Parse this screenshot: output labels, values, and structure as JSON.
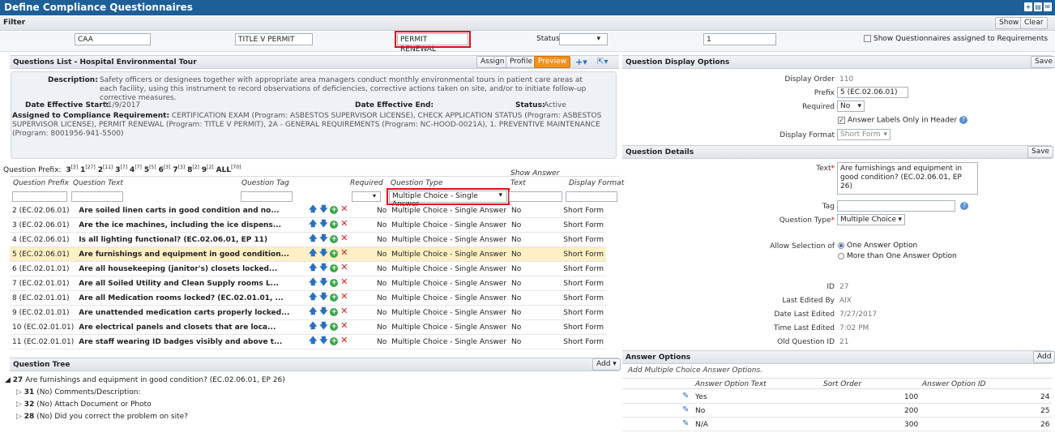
{
  "title": "Define Compliance Questionnaires",
  "filter": {
    "label": "Filter",
    "show": "Show",
    "clear": "Clear",
    "f1": "CAA",
    "f2": "TITLE V PERMIT",
    "f3": "PERMIT RENEWAL",
    "status_label": "Status",
    "status_value": "",
    "f5": "1",
    "show_assigned": "Show Questionnaires assigned to Requirements"
  },
  "qlist": {
    "title": "Questions List - Hospital Environmental Tour",
    "assign": "Assign",
    "profile": "Profile",
    "preview": "Preview",
    "description_label": "Description:",
    "description": "Safety officers or designees together with appropriate area managers conduct monthly environmental tours in patient care areas at each facility, using this instrument to record observations of deficiencies, corrective actions taken on site, and/or to initiate follow-up corrective measures.",
    "des_start_label": "Date Effective Start:",
    "des_start": "01/9/2017",
    "des_end_label": "Date Effective End:",
    "status_label": "Status:",
    "status": "Active",
    "assigned_label": "Assigned to Compliance Requirement:",
    "assigned": "CERTIFICATION EXAM (Program: ASBESTOS SUPERVISOR LICENSE), CHECK APPLICATION STATUS (Program: ASBESTOS SUPERVISOR LICENSE), PERMIT RENEWAL (Program: TITLE V PERMIT), 2A - GENERAL REQUIREMENTS (Program: NC-HOOD-0021A), 1. PREVENTIVE MAINTENANCE (Program: 8001956-941-5500)",
    "prefix_label": "Question Prefix:",
    "prefixes": [
      {
        "p": "3",
        "c": "[3]"
      },
      {
        "p": "1",
        "c": "[27]"
      },
      {
        "p": "2",
        "c": "[11]"
      },
      {
        "p": "3",
        "c": "[7]"
      },
      {
        "p": "4",
        "c": "[7]"
      },
      {
        "p": "5",
        "c": "[5]"
      },
      {
        "p": "6",
        "c": "[3]"
      },
      {
        "p": "7",
        "c": "[3]"
      },
      {
        "p": "8",
        "c": "[2]"
      },
      {
        "p": "9",
        "c": "[2]"
      },
      {
        "p": "ALL",
        "c": "[70]"
      }
    ],
    "col_prefix": "Question Prefix",
    "col_text": "Question Text",
    "col_tag": "Question Tag",
    "col_required": "Required",
    "col_type": "Question Type",
    "col_show_answer_1": "Show Answer",
    "col_show_answer_2": "Text",
    "col_display": "Display Format",
    "type_filter": "Multiple Choice - Single Answer",
    "rows": [
      {
        "prefix": "2 (EC.02.06.01)",
        "text": "Are soiled linen carts in good condition and no...",
        "req": "No",
        "type": "Multiple Choice - Single Answer",
        "show": "No",
        "fmt": "Short Form"
      },
      {
        "prefix": "3 (EC.02.06.01)",
        "text": "Are the ice machines, including the ice dispens...",
        "req": "No",
        "type": "Multiple Choice - Single Answer",
        "show": "No",
        "fmt": "Short Form"
      },
      {
        "prefix": "4 (EC.02.06.01)",
        "text": "Is all lighting functional? (EC.02.06.01, EP 11)",
        "req": "No",
        "type": "Multiple Choice - Single Answer",
        "show": "No",
        "fmt": "Short Form"
      },
      {
        "prefix": "5 (EC.02.06.01)",
        "text": "Are furnishings and equipment in good condition...",
        "req": "No",
        "type": "Multiple Choice - Single Answer",
        "show": "No",
        "fmt": "Short Form"
      },
      {
        "prefix": "6 (EC.02.01.01)",
        "text": "Are all housekeeping (janitor's) closets locked...",
        "req": "No",
        "type": "Multiple Choice - Single Answer",
        "show": "No",
        "fmt": "Short Form"
      },
      {
        "prefix": "7 (EC.02.01.01)",
        "text": "Are all Soiled Utility and Clean Supply rooms L...",
        "req": "No",
        "type": "Multiple Choice - Single Answer",
        "show": "No",
        "fmt": "Short Form"
      },
      {
        "prefix": "8 (EC.02.01.01)",
        "text": "Are all Medication rooms locked? (EC.02.01.01, ...",
        "req": "No",
        "type": "Multiple Choice - Single Answer",
        "show": "No",
        "fmt": "Short Form"
      },
      {
        "prefix": "9 (EC.02.01.01)",
        "text": "Are unattended medication carts properly locked...",
        "req": "No",
        "type": "Multiple Choice - Single Answer",
        "show": "No",
        "fmt": "Short Form"
      },
      {
        "prefix": "10 (EC.02.01.01)",
        "text": "Are electrical panels and closets that are loca...",
        "req": "No",
        "type": "Multiple Choice - Single Answer",
        "show": "No",
        "fmt": "Short Form"
      },
      {
        "prefix": "11 (EC.02.01.01)",
        "text": "Are staff wearing ID badges visibly and above t...",
        "req": "No",
        "type": "Multiple Choice - Single Answer",
        "show": "No",
        "fmt": "Short Form"
      }
    ]
  },
  "tree": {
    "title": "Question Tree",
    "add": "Add",
    "root_id": "27",
    "root_text": "Are furnishings and equipment in good condition? (EC.02.06.01, EP 26)",
    "children": [
      {
        "id": "31",
        "text": "(No) Comments/Description:"
      },
      {
        "id": "32",
        "text": "(No) Attach Document or Photo"
      },
      {
        "id": "28",
        "text": "(No) Did you correct the problem on site?"
      }
    ]
  },
  "display_options": {
    "title": "Question Display Options",
    "save": "Save",
    "order_label": "Display Order",
    "order": "110",
    "prefix_label": "Prefix",
    "prefix": "5 (EC.02.06.01)",
    "required_label": "Required",
    "required": "No",
    "answer_labels": "Answer Labels Only in Header",
    "format_label": "Display Format",
    "format": "Short Form"
  },
  "details": {
    "title": "Question Details",
    "save": "Save",
    "text_label": "Text",
    "text": "Are furnishings and equipment in good condition? (EC.02.06.01, EP 26)",
    "tag_label": "Tag",
    "type_label": "Question Type",
    "type": "Multiple Choice",
    "allow_label": "Allow Selection of",
    "opt1": "One Answer Option",
    "opt2": "More than One Answer Option",
    "id_label": "ID",
    "id": "27",
    "edited_by_label": "Last Edited By",
    "edited_by": "AIX",
    "date_label": "Date Last Edited",
    "date": "7/27/2017",
    "time_label": "Time Last Edited",
    "time": "7:02 PM",
    "old_id_label": "Old Question ID",
    "old_id": "21"
  },
  "answers": {
    "title": "Answer Options",
    "add": "Add",
    "hint": "Add Multiple Choice Answer Options.",
    "col_text": "Answer Option Text",
    "col_sort": "Sort Order",
    "col_id": "Answer Option ID",
    "rows": [
      {
        "text": "Yes",
        "sort": "100",
        "id": "24"
      },
      {
        "text": "No",
        "sort": "200",
        "id": "25"
      },
      {
        "text": "N/A",
        "sort": "300",
        "id": "26"
      }
    ]
  }
}
